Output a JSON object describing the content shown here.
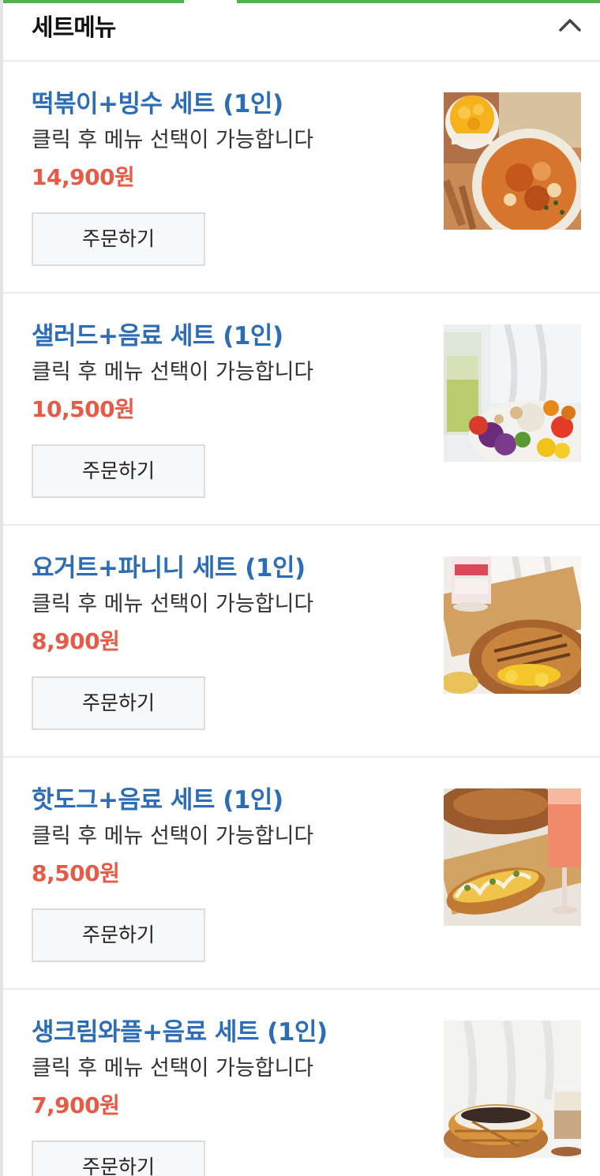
{
  "section": {
    "title": "세트메뉴",
    "collapse_icon": "chevron-up-icon"
  },
  "colors": {
    "accent_green": "#4cb44a",
    "name_blue": "#2c6db5",
    "price_red": "#e85a45"
  },
  "menu_items": [
    {
      "name": "떡볶이+빙수 세트 (1인)",
      "description": "클릭 후 메뉴 선택이 가능합니다",
      "price": "14,900원",
      "order_label": "주문하기",
      "image": "tteokbokki-bingsu-photo"
    },
    {
      "name": "샐러드+음료 세트 (1인)",
      "description": "클릭 후 메뉴 선택이 가능합니다",
      "price": "10,500원",
      "order_label": "주문하기",
      "image": "salad-drink-photo"
    },
    {
      "name": "요거트+파니니 세트 (1인)",
      "description": "클릭 후 메뉴 선택이 가능합니다",
      "price": "8,900원",
      "order_label": "주문하기",
      "image": "yogurt-panini-photo"
    },
    {
      "name": "핫도그+음료 세트 (1인)",
      "description": "클릭 후 메뉴 선택이 가능합니다",
      "price": "8,500원",
      "order_label": "주문하기",
      "image": "hotdog-drink-photo"
    },
    {
      "name": "생크림와플+음료 세트 (1인)",
      "description": "클릭 후 메뉴 선택이 가능합니다",
      "price": "7,900원",
      "order_label": "주문하기",
      "image": "cream-waffle-drink-photo"
    }
  ]
}
